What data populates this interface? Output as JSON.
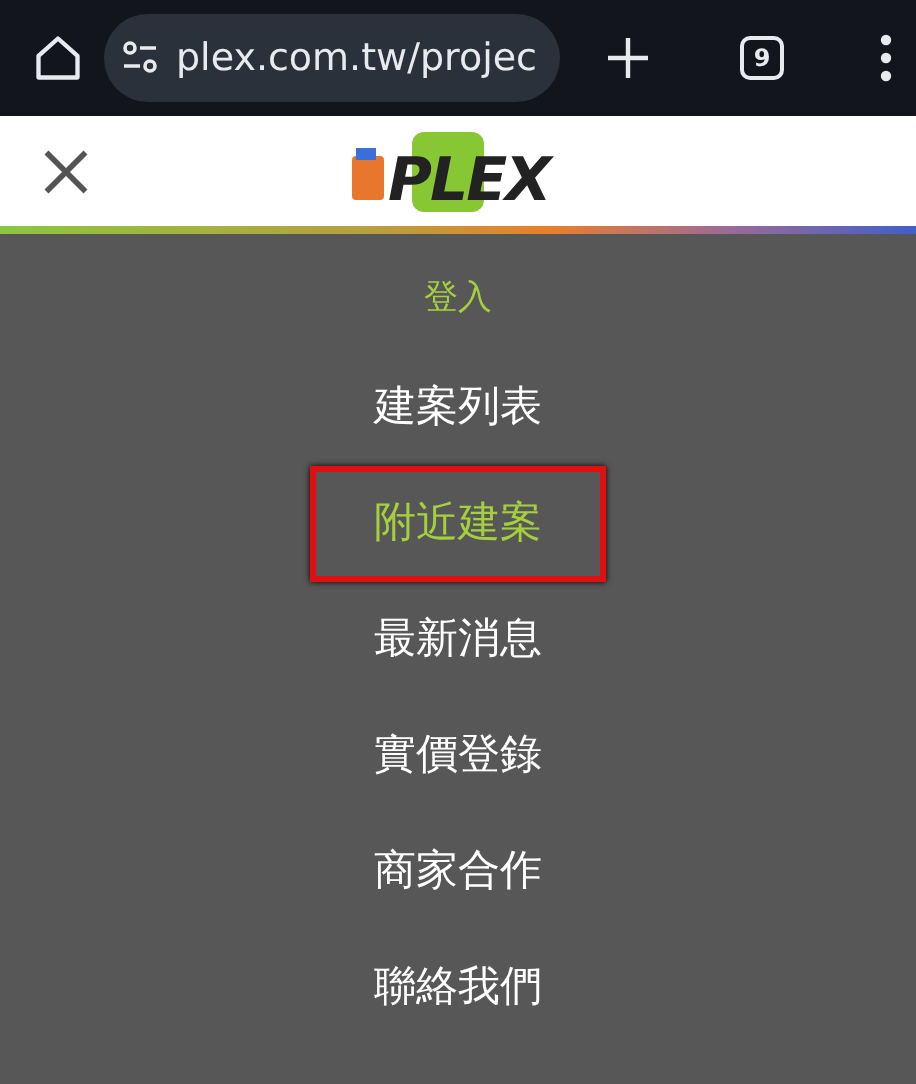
{
  "browser": {
    "url": "plex.com.tw/projec",
    "tab_count": "9"
  },
  "header": {
    "logo": "PLEX"
  },
  "menu": {
    "login": "登入",
    "items": [
      {
        "label": "建案列表",
        "selected": false,
        "outlined": false
      },
      {
        "label": "附近建案",
        "selected": true,
        "outlined": true
      },
      {
        "label": "最新消息",
        "selected": false,
        "outlined": false
      },
      {
        "label": "實價登錄",
        "selected": false,
        "outlined": false
      },
      {
        "label": "商家合作",
        "selected": false,
        "outlined": false
      },
      {
        "label": "聯絡我們",
        "selected": false,
        "outlined": false
      }
    ]
  }
}
